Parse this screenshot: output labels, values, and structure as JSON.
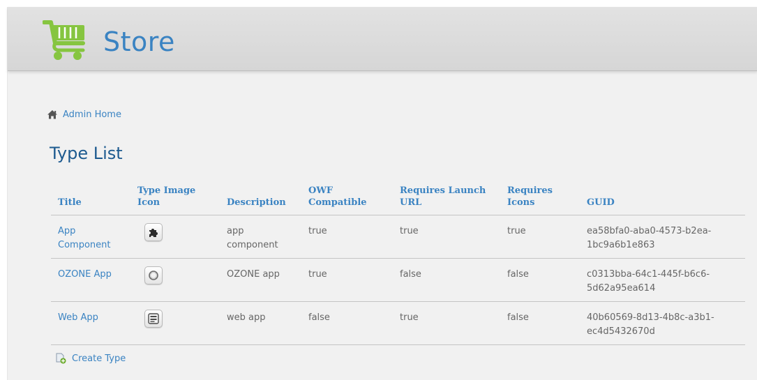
{
  "header": {
    "brand": "Store",
    "logo_icon": "shopping-cart-icon",
    "colors": {
      "accent": "#3a83c2",
      "logo_green": "#86c540",
      "title": "#1d5a8f"
    }
  },
  "breadcrumb": {
    "icon": "home-icon",
    "label": "Admin Home"
  },
  "page_title": "Type List",
  "table": {
    "columns": [
      "Title",
      "Type Image Icon",
      "Description",
      "OWF Compatible",
      "Requires Launch URL",
      "Requires Icons",
      "GUID"
    ],
    "rows": [
      {
        "title": "App Component",
        "icon": "puzzle-icon",
        "description": "app component",
        "owf_compatible": "true",
        "requires_launch_url": "true",
        "requires_icons": "true",
        "guid": "ea58bfa0-aba0-4573-b2ea-1bc9a6b1e863"
      },
      {
        "title": "OZONE App",
        "icon": "ozone-ring-icon",
        "description": "OZONE app",
        "owf_compatible": "true",
        "requires_launch_url": "false",
        "requires_icons": "false",
        "guid": "c0313bba-64c1-445f-b6c6-5d62a95ea614"
      },
      {
        "title": "Web App",
        "icon": "web-app-icon",
        "description": "web app",
        "owf_compatible": "false",
        "requires_launch_url": "true",
        "requires_icons": "false",
        "guid": "40b60569-8d13-4b8c-a3b1-ec4d5432670d"
      }
    ]
  },
  "create": {
    "icon": "create-document-icon",
    "label": "Create Type"
  }
}
